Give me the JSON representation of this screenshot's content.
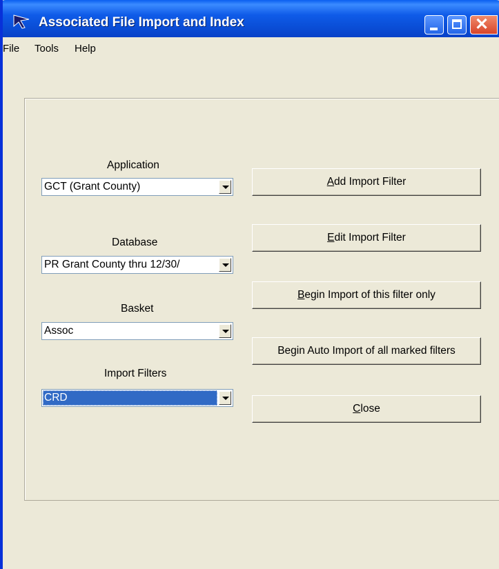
{
  "window": {
    "title": "Associated File Import and Index",
    "controls": [
      "minimize-icon",
      "maximize-icon",
      "close-icon"
    ],
    "colors": {
      "titlebar": "#0a4fd8",
      "face": "#ece9d8",
      "selection": "#316ac5",
      "close": "#d8452a"
    }
  },
  "menu": {
    "file": "File",
    "tools": "Tools",
    "help": "Help"
  },
  "fields": {
    "application": {
      "label": "Application",
      "value": "GCT  (Grant County)"
    },
    "database": {
      "label": "Database",
      "value": "PR Grant County thru 12/30/"
    },
    "basket": {
      "label": "Basket",
      "value": "Assoc"
    },
    "import_filters": {
      "label": "Import Filters",
      "value": "CRD"
    }
  },
  "buttons": {
    "add_filter": {
      "mnemonic": "A",
      "rest": "dd Import Filter"
    },
    "edit_filter": {
      "mnemonic": "E",
      "rest": "dit Import Filter"
    },
    "begin_import": {
      "mnemonic": "B",
      "rest": "egin Import of this filter only"
    },
    "auto_import": "Begin Auto Import of all marked filters",
    "close": {
      "mnemonic": "C",
      "rest": "lose"
    }
  }
}
